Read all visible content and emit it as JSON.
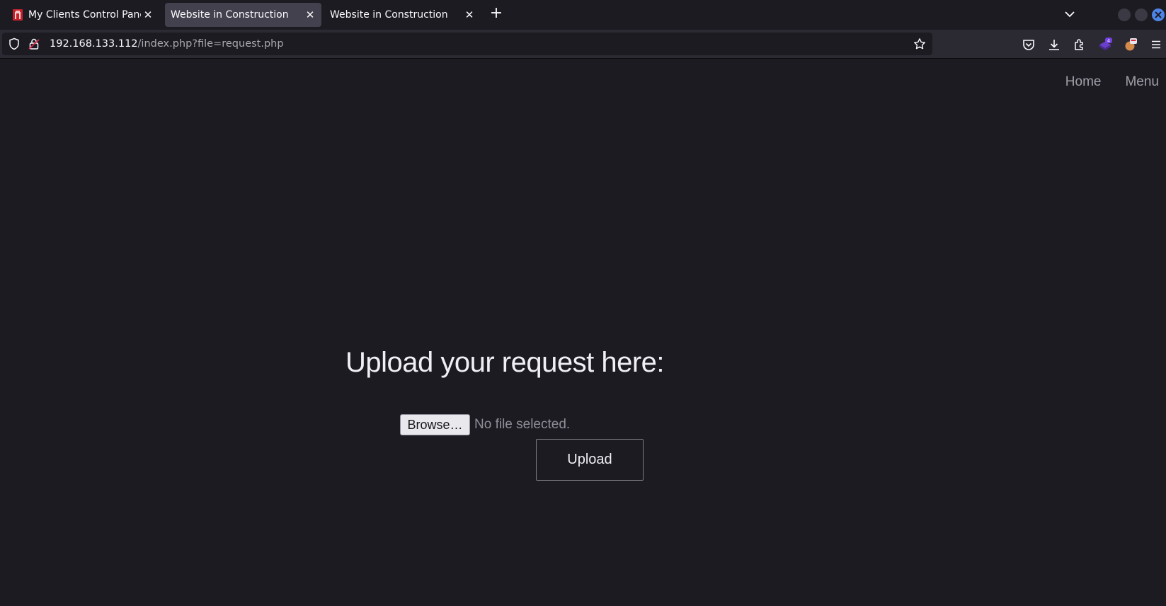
{
  "tabs": [
    {
      "label": "My Clients Control Panel | ",
      "active": false,
      "favicon": "red-gate-icon"
    },
    {
      "label": "Website in Construction",
      "active": true
    },
    {
      "label": "Website in Construction",
      "active": false
    }
  ],
  "urlbar": {
    "host": "192.168.133.112",
    "path": "/index.php?file=request.php"
  },
  "toolbar": {
    "icons": [
      "pocket-icon",
      "download-icon",
      "extensions-icon",
      "extension-badge-icon",
      "profile-icon",
      "menu-icon"
    ],
    "extension_badge": "4"
  },
  "site": {
    "nav": {
      "home": "Home",
      "menu": "Menu"
    },
    "upload_title": "Upload your request here:",
    "browse_label": "Browse…",
    "no_file_label": "No file selected.",
    "upload_label": "Upload"
  },
  "colors": {
    "background": "#1c1b22",
    "toolbar": "#2b2a33",
    "active_tab": "#42414d",
    "accent": "#4d84e8"
  }
}
